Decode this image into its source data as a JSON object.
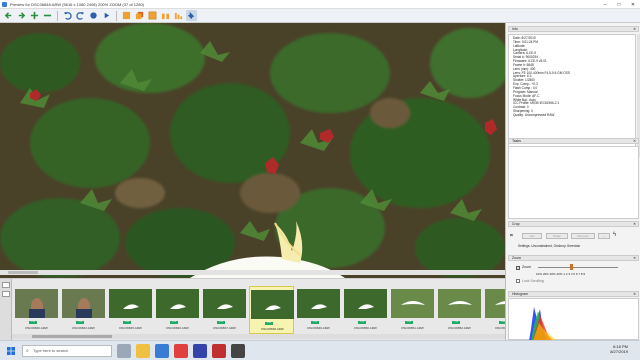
{
  "window": {
    "title": "Preview for DSC06848.ARW (5616 x 1080 2408) 200% ZOOM (37 of 1280)"
  },
  "toolbar": {
    "icons": [
      "prev-arrow-icon",
      "next-arrow-icon",
      "add-icon",
      "remove-icon",
      "rotate-left-icon",
      "rotate-right-icon",
      "color-icon",
      "play-icon",
      "image-icon",
      "copy-icon",
      "grid-icon",
      "compare-icon",
      "bar-icon",
      "pin-icon"
    ]
  },
  "filmstrip": {
    "items": [
      {
        "caption": "DSC06846.ARW",
        "badge": "1.00",
        "scene": "person"
      },
      {
        "caption": "DSC06843.ARW",
        "badge": "1.00",
        "scene": "person"
      },
      {
        "caption": "DSC06845.ARW",
        "badge": "1.00",
        "scene": "bird-green"
      },
      {
        "caption": "DSC06846.ARW",
        "badge": "1.00",
        "scene": "bird-green"
      },
      {
        "caption": "DSC06847.ARW",
        "badge": "1.00",
        "scene": "bird-green"
      },
      {
        "caption": "DSC06848.ARW",
        "badge": "1.00",
        "scene": "bird-green",
        "selected": true
      },
      {
        "caption": "DSC06849.ARW",
        "badge": "1.00",
        "scene": "bird-green"
      },
      {
        "caption": "DSC06850.ARW",
        "badge": "1.00",
        "scene": "bird-green"
      },
      {
        "caption": "DSC06851.ARW",
        "badge": "1.00",
        "scene": "bird-flying"
      },
      {
        "caption": "DSC06852.ARW",
        "badge": "1.00",
        "scene": "bird-flying"
      },
      {
        "caption": "DSC06853.ARW",
        "badge": "1.00",
        "scene": "bird-flying"
      }
    ]
  },
  "panel": {
    "info_title": "Info",
    "info_lines": [
      "Date: 8/27/2019",
      "Time: 3:01:24 PM",
      "Latitude:",
      "Longitude:",
      "Camera: ILCE-9",
      "Serial #: 9000254",
      "Firmware: ILCE-9 v5.01",
      "Frame #: 6848",
      "Lens (mm): 400",
      "Lens: FE 100-400mm F4.5-5.6 GM OSS",
      "Aperture: 6.3",
      "Shutter: 1/2500",
      "Exp. Comp.: +0.3",
      "Flash Comp.: 0.0",
      "Program: Manual",
      "Focus Mode: AF-C",
      "White Bal.: Auto",
      "ICC Profile: sRGB IEC61966-2.1",
      "Contrast: 0",
      "Sharpening: 0",
      "Quality: Uncompressed RAW"
    ],
    "tasks_title": "Tasks",
    "crop_title": "Crop",
    "crop_buttons": [
      "Get",
      "Paste",
      "Remove",
      "..."
    ],
    "crop_settings": "Settings:  Unconstrained, Gridcrop Greenbar",
    "zoom_title": "Zoom",
    "zoom_checkbox": "Zoom",
    "zoom_ticks": "10%  20%  30%  40%  1  2  3  4  5  6  7  8  9",
    "lock_scrolling": "Lock Scrolling",
    "histogram_title": "Histogram"
  },
  "taskbar": {
    "search_placeholder": "Type here to search",
    "time": "6:18 PM",
    "date": "8/27/2019"
  },
  "colors": {
    "accent": "#3a7bd5",
    "selection": "#f7f3b0"
  }
}
